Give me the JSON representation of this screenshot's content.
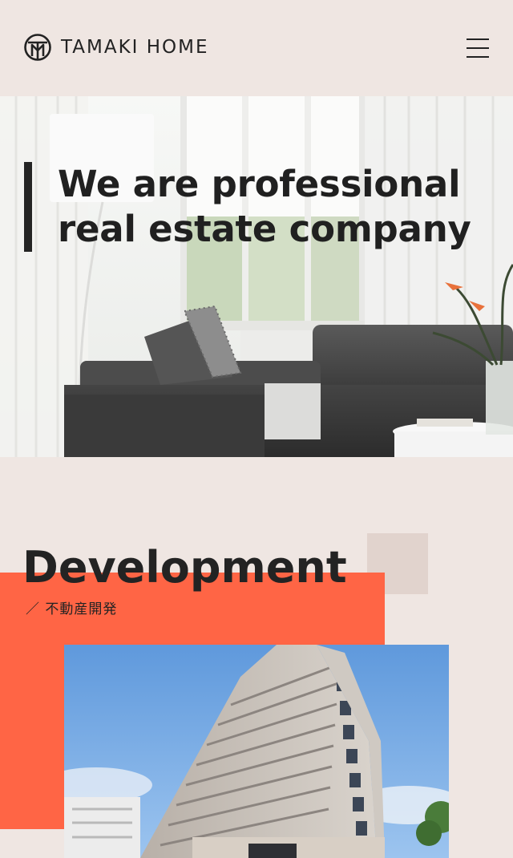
{
  "header": {
    "logo_text": "TAMAKI HOME",
    "logo_icon": "tamaki-home-logo-icon",
    "menu_icon": "hamburger-menu-icon"
  },
  "hero": {
    "title": "We are professional\nreal estate company"
  },
  "development": {
    "title": "Development",
    "subtitle": "／ 不動産開発"
  },
  "colors": {
    "background": "#efe6e2",
    "accent": "#ff6545",
    "deco": "#e1d3cd",
    "text": "#232323"
  }
}
